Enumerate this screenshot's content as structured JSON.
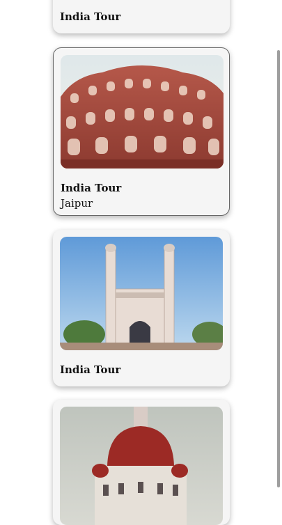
{
  "cards": [
    {
      "title": "India Tour",
      "subtitle": "",
      "image": "tour-image"
    },
    {
      "title": "India Tour",
      "subtitle": "Jaipur",
      "image": "hawa-mahal-photo"
    },
    {
      "title": "India Tour",
      "subtitle": "",
      "image": "charminar-photo"
    },
    {
      "title": "",
      "subtitle": "",
      "image": "taj-hotel-photo"
    }
  ],
  "colors": {
    "card_bg": "#f5f5f5",
    "scrollbar": "#9e9e9e"
  }
}
